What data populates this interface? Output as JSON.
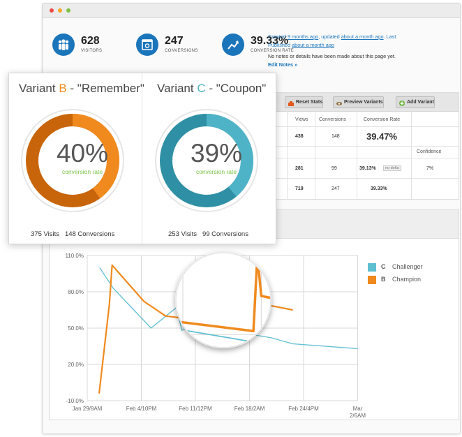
{
  "stats": [
    {
      "value": "628",
      "label": "VISITORS",
      "icon": "people-icon"
    },
    {
      "value": "247",
      "label": "CONVERSIONS",
      "icon": "browser-window-icon"
    },
    {
      "value": "39.33%",
      "label": "CONVERSION RATE",
      "icon": "trend-up-icon"
    }
  ],
  "meta": {
    "created_prefix": "Created ",
    "created_link": "9 months ago",
    "updated_prefix": ", updated ",
    "updated_link": "about a month ago",
    "last_prefix": ". Last Published ",
    "last_link": "about a month ago",
    "notes": "No notes or details have been made about this page yet.",
    "edit_link": "Edit Notes »"
  },
  "toolbar": {
    "reset": "Reset Stats",
    "preview": "Preview Variants",
    "add": "Add Variant"
  },
  "table": {
    "headers": {
      "visitors_partial": "rs",
      "views": "Views",
      "conversions": "Conversions",
      "rate": "Conversion Rate",
      "confidence": "Confidence"
    },
    "row1": {
      "views": "438",
      "conversions": "148",
      "rate": "39.47%"
    },
    "row2": {
      "views": "281",
      "conversions": "99",
      "rate": "39.13%",
      "badge": "no delta",
      "confidence": "7%"
    },
    "row3": {
      "views": "719",
      "conversions": "247",
      "rate": "39.33%"
    }
  },
  "variants": [
    {
      "prefix": "Variant ",
      "letter": "B",
      "name": " - \"Remember\"",
      "percent": "40%",
      "rate_label": "conversion rate",
      "rate_value": 0.4,
      "visits": "375 Visits",
      "conversions": "148 Conversions",
      "color": "#f08a1e",
      "dark": "#c8640a",
      "letter_color": "#f08a1e"
    },
    {
      "prefix": "Variant ",
      "letter": "C",
      "name": " - \"Coupon\"",
      "percent": "39%",
      "rate_label": "conversion rate",
      "rate_value": 0.39,
      "visits": "253 Visits",
      "conversions": "99 Conversions",
      "color": "#4fb3c8",
      "dark": "#2f8fa4",
      "letter_color": "#4fb3c8"
    }
  ],
  "chart_data": {
    "type": "line",
    "x_ticks": [
      "Jan 29/8AM",
      "Feb 4/10PM",
      "Feb 11/12PM",
      "Feb 18/2AM",
      "Feb 24/4PM",
      "Mar 2/6AM"
    ],
    "y_ticks": [
      "110.0%",
      "80.0%",
      "50.0%",
      "20.0%",
      "-10.0%"
    ],
    "ylim": [
      -10,
      110
    ],
    "grid": true,
    "legend_position": "right",
    "series": [
      {
        "name": "Challenger",
        "letter": "C",
        "color": "#5ebfd1",
        "points": [
          [
            0.23,
            100
          ],
          [
            0.48,
            83
          ],
          [
            1.18,
            50
          ],
          [
            1.65,
            67
          ],
          [
            1.75,
            48
          ],
          [
            1.95,
            53
          ],
          [
            3.4,
            42
          ],
          [
            3.8,
            37
          ],
          [
            5.0,
            33
          ]
        ]
      },
      {
        "name": "Champion",
        "letter": "B",
        "color": "#f08a1e",
        "points": [
          [
            0.22,
            -4
          ],
          [
            0.41,
            70
          ],
          [
            0.46,
            102
          ],
          [
            1.05,
            72
          ],
          [
            1.45,
            60
          ],
          [
            2.9,
            52
          ],
          [
            2.95,
            95
          ],
          [
            3.0,
            72
          ],
          [
            3.8,
            65
          ]
        ]
      }
    ]
  }
}
